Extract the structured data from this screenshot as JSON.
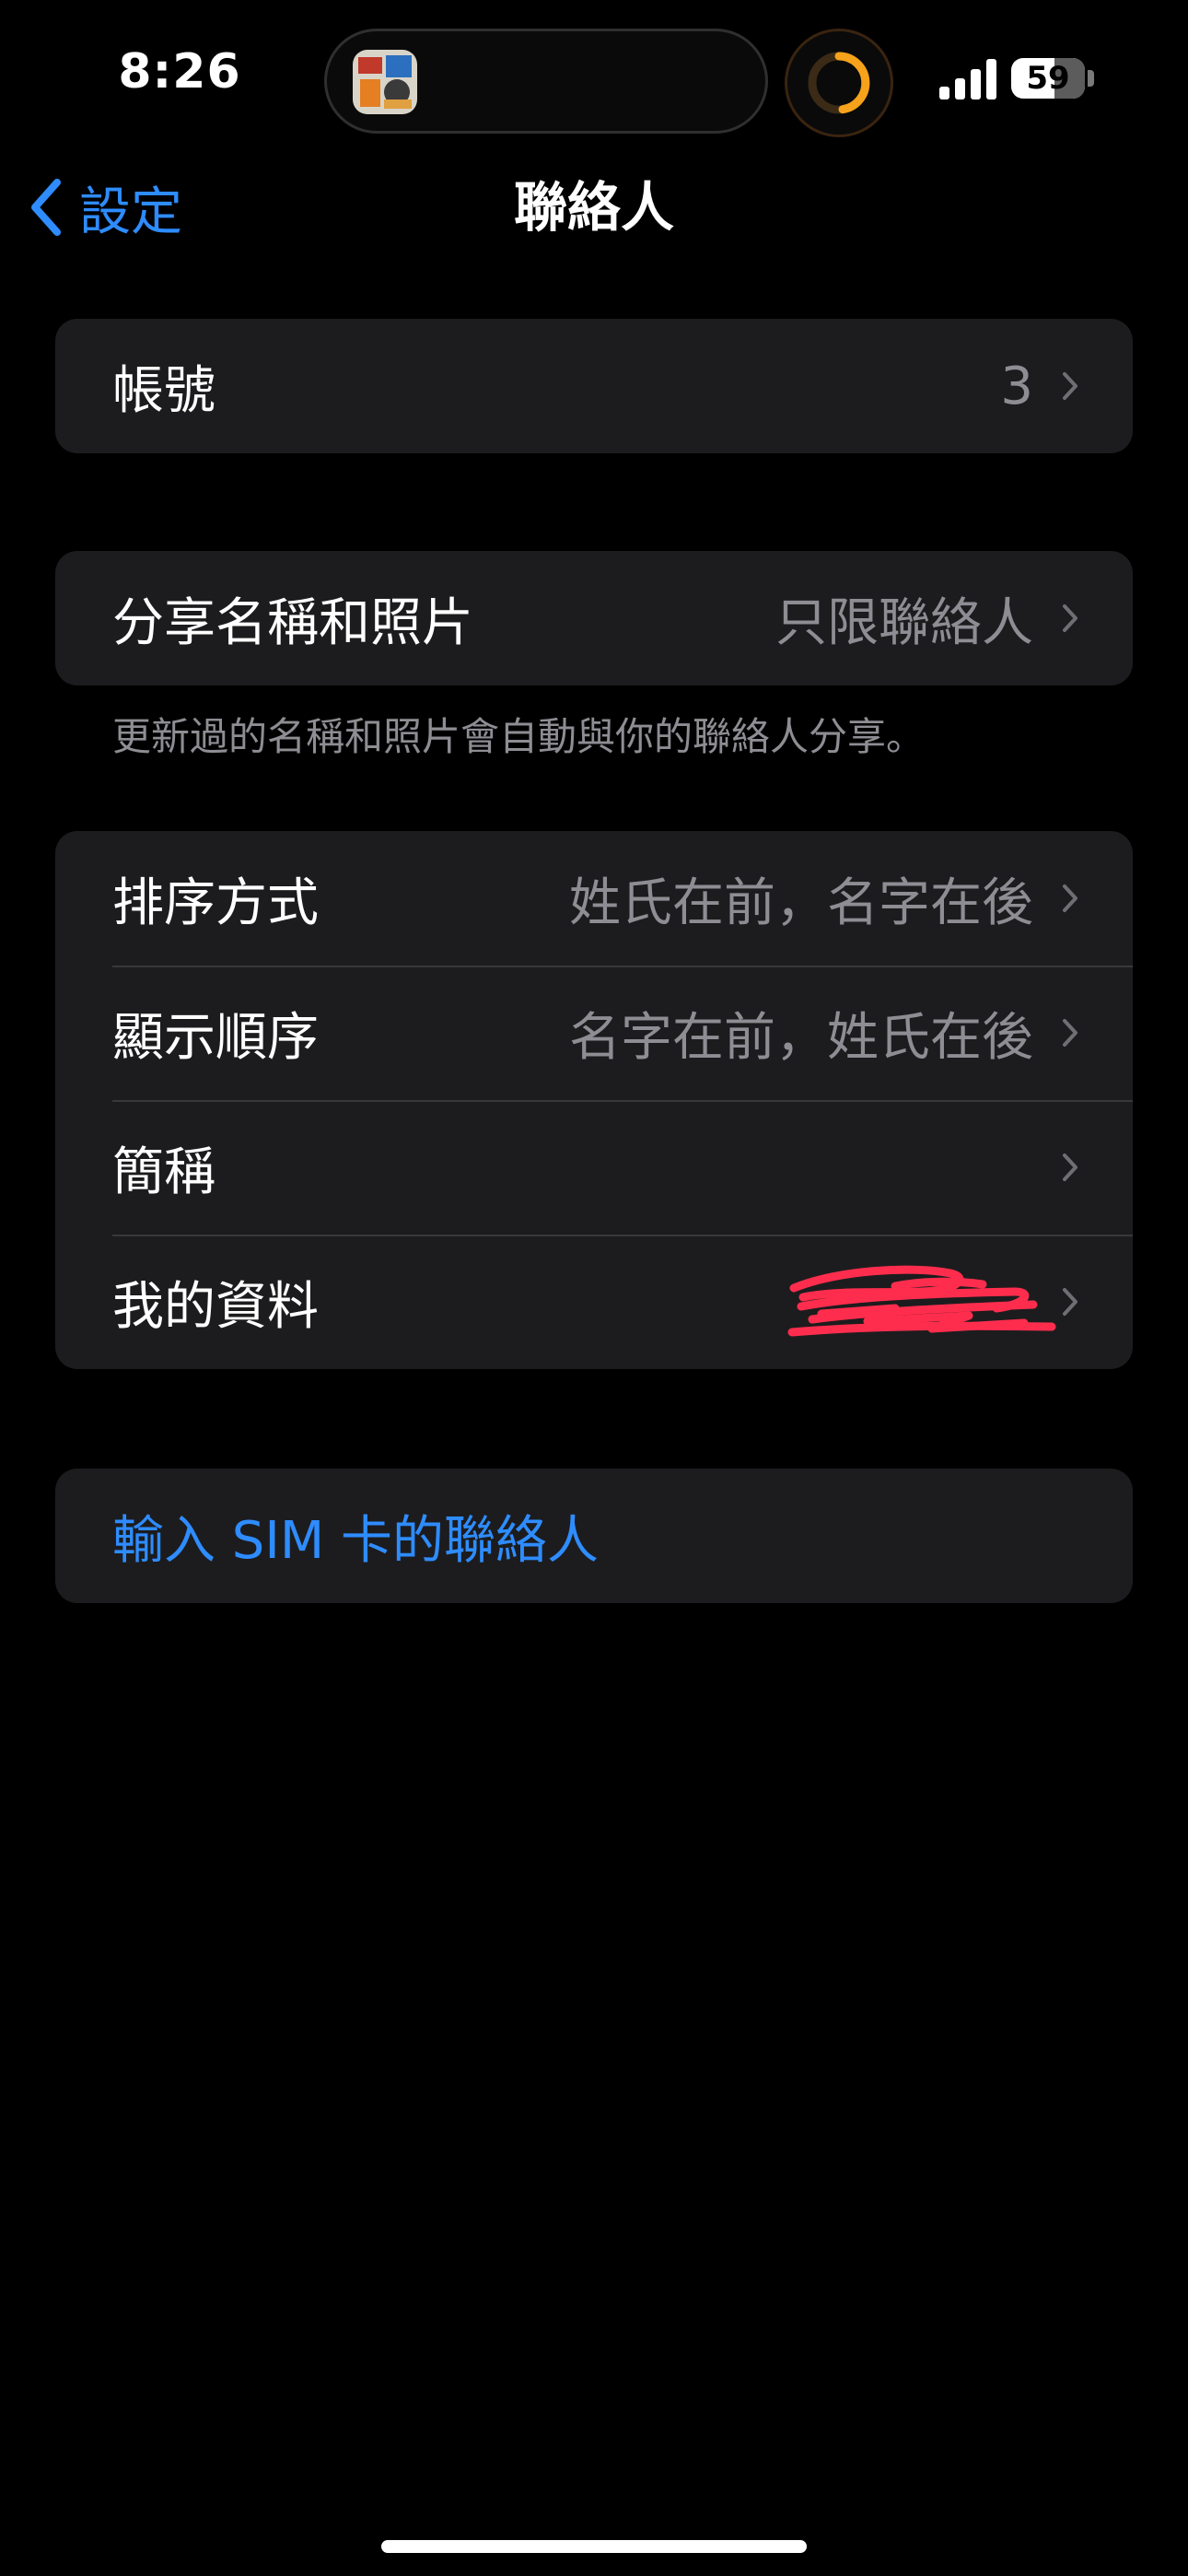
{
  "status_bar": {
    "time": "8:26",
    "battery_level": "59",
    "battery_fraction": 0.59,
    "signal_icon": "signal-bars-icon",
    "activity_icon": "activity-ring-icon"
  },
  "nav": {
    "back_label": "設定",
    "title": "聯絡人"
  },
  "groups": {
    "accounts": {
      "label": "帳號",
      "value": "3"
    },
    "sharing": {
      "label": "分享名稱和照片",
      "value": "只限聯絡人",
      "footer": "更新過的名稱和照片會自動與你的聯絡人分享。"
    },
    "display": {
      "sort_order": {
        "label": "排序方式",
        "value": "姓氏在前，名字在後"
      },
      "display_order": {
        "label": "顯示順序",
        "value": "名字在前，姓氏在後"
      },
      "short_name": {
        "label": "簡稱"
      },
      "my_info": {
        "label": "我的資料"
      }
    },
    "sim": {
      "label": "輸入 SIM 卡的聯絡人"
    }
  },
  "colors": {
    "accent": "#2e8cff",
    "cell_background": "#1c1c1e",
    "secondary_text": "#8d8d93",
    "redaction": "#ff2d4d"
  }
}
